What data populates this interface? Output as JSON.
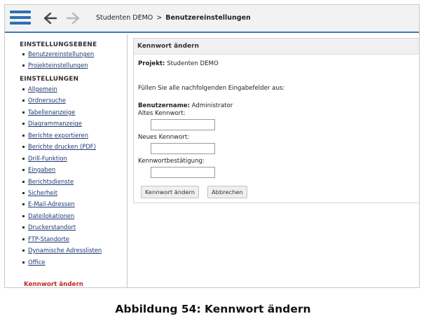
{
  "breadcrumb": {
    "root": "Studenten DEMO",
    "separator": ">",
    "current": "Benutzereinstellungen"
  },
  "sidebar": {
    "section1_title": "EINSTELLUNGSEBENE",
    "section1_items": [
      "Benutzereinstellungen",
      "Projekteinstellungen"
    ],
    "section2_title": "EINSTELLUNGEN",
    "section2_items": [
      "Allgemein",
      "Ordnersuche",
      "Tabellenanzeige",
      "Diagrammanzeige",
      "Berichte exportieren",
      "Berichte drucken (PDF)",
      "Drill-Funktion",
      "Eingaben",
      "Berichtsdienste",
      "Sicherheit",
      "E-Mail-Adressen",
      "Dateilokationen",
      "Druckerstandort",
      "FTP-Standorte",
      "Dynamische Adresslisten",
      "Office"
    ],
    "active_item": "Kennwort ändern"
  },
  "panel": {
    "title": "Kennwort ändern",
    "project_label": "Projekt:",
    "project_value": "Studenten DEMO",
    "instruction": "Füllen Sie alle nachfolgenden Eingabefelder aus:",
    "username_label": "Benutzername:",
    "username_value": "Administrator",
    "old_password_label": "Altes Kennwort:",
    "old_password_value": "",
    "new_password_label": "Neues Kennwort:",
    "new_password_value": "",
    "confirm_password_label": "Kennwortbestätigung:",
    "confirm_password_value": "",
    "submit_button": "Kennwort ändern",
    "cancel_button": "Abbrechen"
  },
  "caption": "Abbildung 54: Kennwort ändern",
  "colors": {
    "accent": "#2e6fb3",
    "topbar_border": "#3a7ab8",
    "link": "#1f3b73",
    "active": "#c0282d"
  },
  "icons": {
    "menu": "hamburger-menu-icon",
    "back": "arrow-left-icon",
    "forward": "arrow-right-icon"
  }
}
